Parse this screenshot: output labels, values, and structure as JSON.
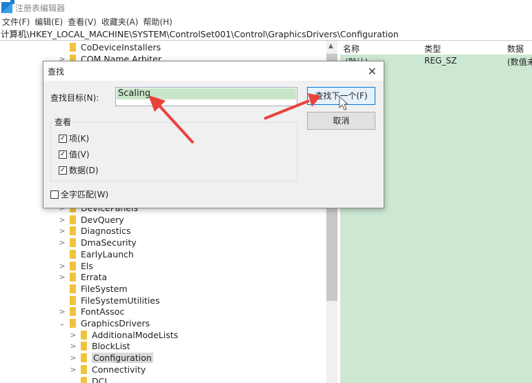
{
  "window": {
    "title": "注册表编辑器"
  },
  "menu": [
    "文件(F)",
    "编辑(E)",
    "查看(V)",
    "收藏夹(A)",
    "帮助(H)"
  ],
  "address": "计算机\\HKEY_LOCAL_MACHINE\\SYSTEM\\ControlSet001\\Control\\GraphicsDrivers\\Configuration",
  "tree_top": [
    {
      "label": "CoDeviceInstallers",
      "level": 0,
      "expander": ""
    },
    {
      "label": "COM Name Arbiter",
      "level": 0,
      "expander": ">"
    }
  ],
  "tree_bottom": [
    {
      "label": "DevicePanels",
      "level": 0,
      "expander": ">"
    },
    {
      "label": "DevQuery",
      "level": 0,
      "expander": ">"
    },
    {
      "label": "Diagnostics",
      "level": 0,
      "expander": ">"
    },
    {
      "label": "DmaSecurity",
      "level": 0,
      "expander": ">"
    },
    {
      "label": "EarlyLaunch",
      "level": 0,
      "expander": ""
    },
    {
      "label": "Els",
      "level": 0,
      "expander": ">"
    },
    {
      "label": "Errata",
      "level": 0,
      "expander": ">"
    },
    {
      "label": "FileSystem",
      "level": 0,
      "expander": ""
    },
    {
      "label": "FileSystemUtilities",
      "level": 0,
      "expander": ""
    },
    {
      "label": "FontAssoc",
      "level": 0,
      "expander": ">"
    },
    {
      "label": "GraphicsDrivers",
      "level": 0,
      "expander": "⌄"
    },
    {
      "label": "AdditionalModeLists",
      "level": 1,
      "expander": ">"
    },
    {
      "label": "BlockList",
      "level": 1,
      "expander": ">"
    },
    {
      "label": "Configuration",
      "level": 1,
      "expander": ">",
      "selected": true
    },
    {
      "label": "Connectivity",
      "level": 1,
      "expander": ">"
    },
    {
      "label": "DCI",
      "level": 1,
      "expander": ""
    }
  ],
  "values_pane": {
    "headers": [
      "名称",
      "类型",
      "数据"
    ],
    "rows": [
      {
        "name": "(默认)",
        "type": "REG_SZ",
        "data": "(数值未"
      }
    ]
  },
  "find_dialog": {
    "title": "查找",
    "target_label": "查找目标(N):",
    "target_value": "Scaling",
    "find_next": "查找下一个(F)",
    "cancel": "取消",
    "look_at": "查看",
    "options": [
      {
        "label": "项(K)",
        "checked": true
      },
      {
        "label": "值(V)",
        "checked": true
      },
      {
        "label": "数据(D)",
        "checked": true
      }
    ],
    "match_whole": {
      "label": "全字匹配(W)",
      "checked": false
    }
  },
  "colors": {
    "highlight": "#cce8d2",
    "arrow": "#e8443a",
    "folder": "#f1c33c"
  }
}
